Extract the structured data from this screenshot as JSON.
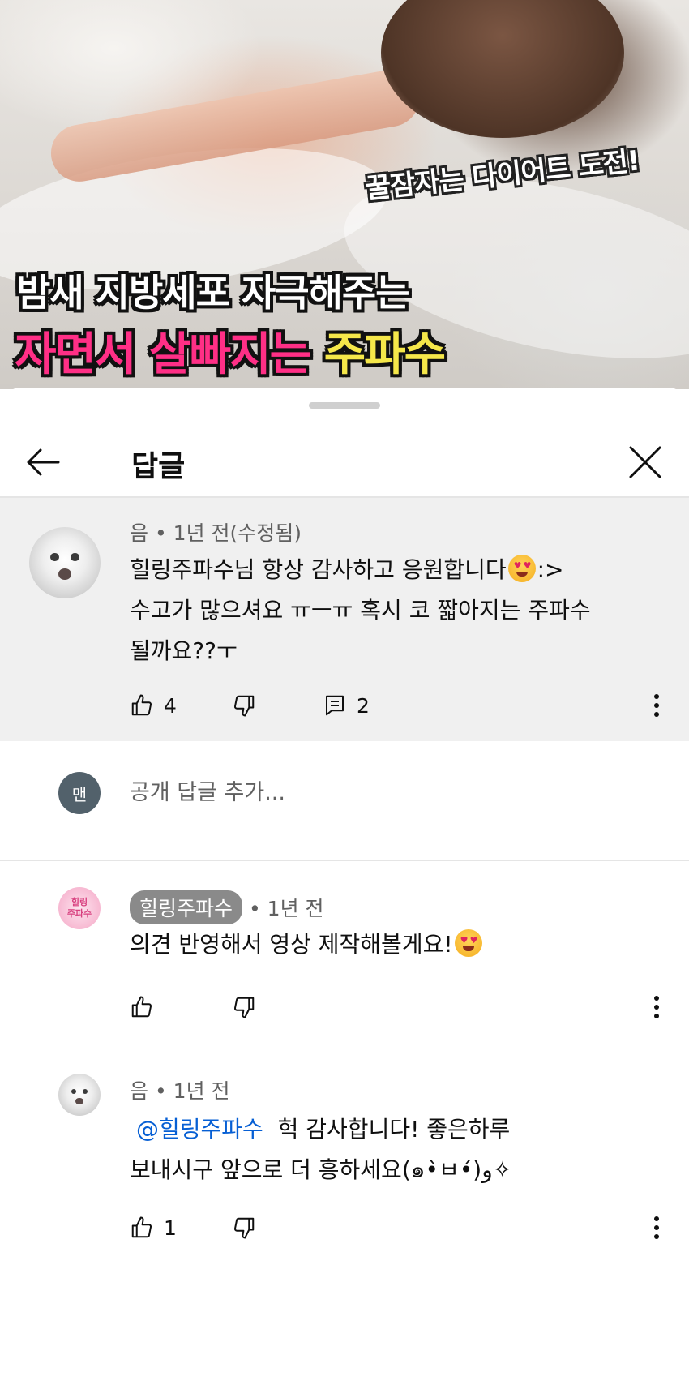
{
  "video": {
    "badge": "꿀잠자는 다이어트 도전!",
    "headline_line1": "밤새 지방세포 자극해주는",
    "headline_line2_part1": "자면서 살빠지는",
    "headline_line2_part2": "주파수"
  },
  "sheet": {
    "title": "답글",
    "back_icon": "arrow-left-icon",
    "close_icon": "close-icon"
  },
  "parent_comment": {
    "author": "음",
    "time": "1년 전(수정됨)",
    "lines": [
      "힐링주파수님 항상 감사하고 응원합니다",
      ":>",
      "수고가 많으셔요 ㅠㅡㅠ 혹시 코 짧아지는 주파수",
      "될까요??ㅜ"
    ],
    "likes": "4",
    "replies": "2"
  },
  "reply_input": {
    "avatar_letter": "맨",
    "placeholder": "공개 답글 추가..."
  },
  "replies": [
    {
      "author": "힐링주파수",
      "avatar_text": "힐링\n주파수",
      "time": "1년 전",
      "text": "의견 반영해서 영상 제작해볼게요!",
      "likes": ""
    },
    {
      "author": "음",
      "time": "1년 전",
      "mention": "@힐링주파수",
      "line1": "헉 감사합니다! 좋은하루",
      "line2": "보내시구 앞으로 더 흥하세요(๑•̀ㅂ•́)و✧",
      "likes": "1"
    }
  ],
  "separator_dot": "•",
  "colors": {
    "mention": "#065fd4",
    "parent_bg": "#f0f0f0",
    "accent_pink": "#ff2f86",
    "accent_yellow": "#f5e74a"
  }
}
